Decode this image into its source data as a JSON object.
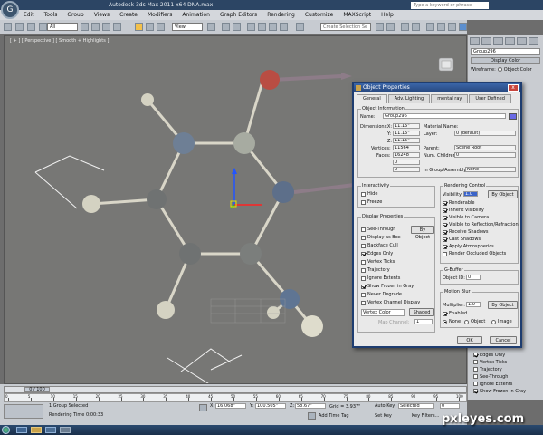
{
  "app": {
    "title": "Autodesk 3ds Max 2011 x64    DNA.max",
    "search_placeholder": "Type a keyword or phrase",
    "logo_glyph": "G"
  },
  "menu": [
    "Edit",
    "Tools",
    "Group",
    "Views",
    "Create",
    "Modifiers",
    "Animation",
    "Graph Editors",
    "Rendering",
    "Customize",
    "MAXScript",
    "Help"
  ],
  "toolbar": {
    "selection_filter": "All",
    "ref_coord": "View",
    "named_selection": "Create Selection Se"
  },
  "viewport": {
    "label": "[ + ] [ Perspective ] [ Smooth + Highlights ]"
  },
  "command_panel": {
    "object_name": "Group296",
    "rollout_title": "Display Color",
    "wireframe_label": "Wireframe:",
    "object_color_label": "Object Color",
    "options": [
      {
        "label": "Edges Only",
        "checked": true
      },
      {
        "label": "Vertex Ticks",
        "checked": false
      },
      {
        "label": "Trajectory",
        "checked": false
      },
      {
        "label": "See-Through",
        "checked": false
      },
      {
        "label": "Ignore Extents",
        "checked": false
      },
      {
        "label": "Show Frozen in Gray",
        "checked": true
      }
    ]
  },
  "dialog": {
    "title": "Object Properties",
    "close": "x",
    "tabs": [
      "General",
      "Adv. Lighting",
      "mental ray",
      "User Defined"
    ],
    "object_info": {
      "group_title": "Object Information",
      "name_label": "Name:",
      "name_value": "Group296",
      "dimensions_label": "Dimensions:",
      "dim_x_label": "X:",
      "dim_x": "11.15\"",
      "dim_y_label": "Y:",
      "dim_y": "11.15\"",
      "dim_z_label": "Z:",
      "dim_z": "11.15\"",
      "vertices_label": "Vertices:",
      "vertices": "11564",
      "faces_label": "Faces:",
      "faces": "16248",
      "extra_1": "0",
      "extra_2": "0",
      "material_label": "Material Name:",
      "layer_label": "Layer:",
      "layer_value": "0 (default)",
      "parent_label": "Parent:",
      "parent_value": "Scene Root",
      "children_label": "Num. Children:",
      "children_value": "0",
      "group_label": "In Group/Assembly:",
      "group_value": "None"
    },
    "interactivity": {
      "title": "Interactivity",
      "hide": "Hide",
      "freeze": "Freeze"
    },
    "display_properties": {
      "title": "Display Properties",
      "by_object": "By Object",
      "items": [
        {
          "label": "See-Through",
          "checked": false
        },
        {
          "label": "Display as Box",
          "checked": false
        },
        {
          "label": "Backface Cull",
          "checked": false
        },
        {
          "label": "Edges Only",
          "checked": true
        },
        {
          "label": "Vertex Ticks",
          "checked": false
        },
        {
          "label": "Trajectory",
          "checked": false
        },
        {
          "label": "Ignore Extents",
          "checked": false
        },
        {
          "label": "Show Frozen in Gray",
          "checked": true
        },
        {
          "label": "Never Degrade",
          "checked": false
        },
        {
          "label": "Vertex Channel Display",
          "checked": false
        }
      ],
      "vertex_color": "Vertex Color",
      "shaded": "Shaded",
      "map_channel_label": "Map Channel:",
      "map_channel_value": "1"
    },
    "rendering_control": {
      "title": "Rendering Control",
      "visibility_label": "Visibility:",
      "visibility_value": "1.0",
      "by_object": "By Object",
      "items": [
        {
          "label": "Renderable",
          "checked": true
        },
        {
          "label": "Inherit Visibility",
          "checked": true
        },
        {
          "label": "Visible to Camera",
          "checked": true
        },
        {
          "label": "Visible to Reflection/Refraction",
          "checked": true
        },
        {
          "label": "Receive Shadows",
          "checked": true
        },
        {
          "label": "Cast Shadows",
          "checked": true
        },
        {
          "label": "Apply Atmospherics",
          "checked": true
        },
        {
          "label": "Render Occluded Objects",
          "checked": false
        }
      ]
    },
    "gbuffer": {
      "title": "G-Buffer",
      "object_id_label": "Object ID:",
      "object_id_value": "0"
    },
    "motion_blur": {
      "title": "Motion Blur",
      "multiplier_label": "Multiplier:",
      "multiplier_value": "1.0",
      "by_object": "By Object",
      "enabled": "Enabled",
      "none": "None",
      "object": "Object",
      "image": "Image"
    },
    "ok": "OK",
    "cancel": "Cancel"
  },
  "timeline": {
    "range": "0 / 100",
    "ticks": [
      "0",
      "5",
      "10",
      "15",
      "20",
      "25",
      "30",
      "35",
      "40",
      "45",
      "50",
      "55",
      "60",
      "65",
      "70",
      "75",
      "80",
      "85",
      "90",
      "95",
      "100"
    ]
  },
  "status": {
    "selected": "1 Group Selected",
    "x_label": "X:",
    "x_value": "16.068\"",
    "y_label": "Y:",
    "y_value": "100.505\"",
    "z_label": "Z:",
    "z_value": "58.67\"",
    "grid": "Grid = 3.937\"",
    "auto_key": "Auto Key",
    "set_key": "Set Key",
    "key_mode": "Selected",
    "key_filters": "Key Filters...",
    "render_time": "Rendering Time 0:00:33",
    "add_time_tag": "Add Time Tag",
    "frame": "0"
  },
  "watermark": "pxleyes.com",
  "colors": {
    "object_swatch": "#6a6ae6",
    "title_bar": "#2c4564",
    "dialog_title": "#2f5595"
  }
}
